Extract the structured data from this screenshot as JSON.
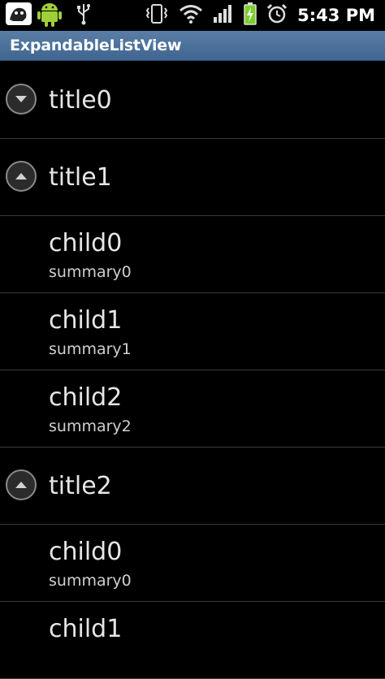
{
  "status_bar": {
    "time": "5:43 PM",
    "icons": [
      "notification-icon",
      "android-icon",
      "usb-icon",
      "vibrate-icon",
      "wifi-icon",
      "signal-icon",
      "battery-charging-icon",
      "alarm-icon"
    ],
    "battery_color": "#7ccf2a"
  },
  "app_bar": {
    "title": "ExpandableListView",
    "color": "#4a7099"
  },
  "list": {
    "groups": [
      {
        "title": "title0",
        "expanded": false
      },
      {
        "title": "title1",
        "expanded": true,
        "children": [
          {
            "title": "child0",
            "summary": "summary0"
          },
          {
            "title": "child1",
            "summary": "summary1"
          },
          {
            "title": "child2",
            "summary": "summary2"
          }
        ]
      },
      {
        "title": "title2",
        "expanded": true,
        "children": [
          {
            "title": "child0",
            "summary": "summary0"
          },
          {
            "title": "child1",
            "summary": ""
          }
        ]
      }
    ]
  }
}
